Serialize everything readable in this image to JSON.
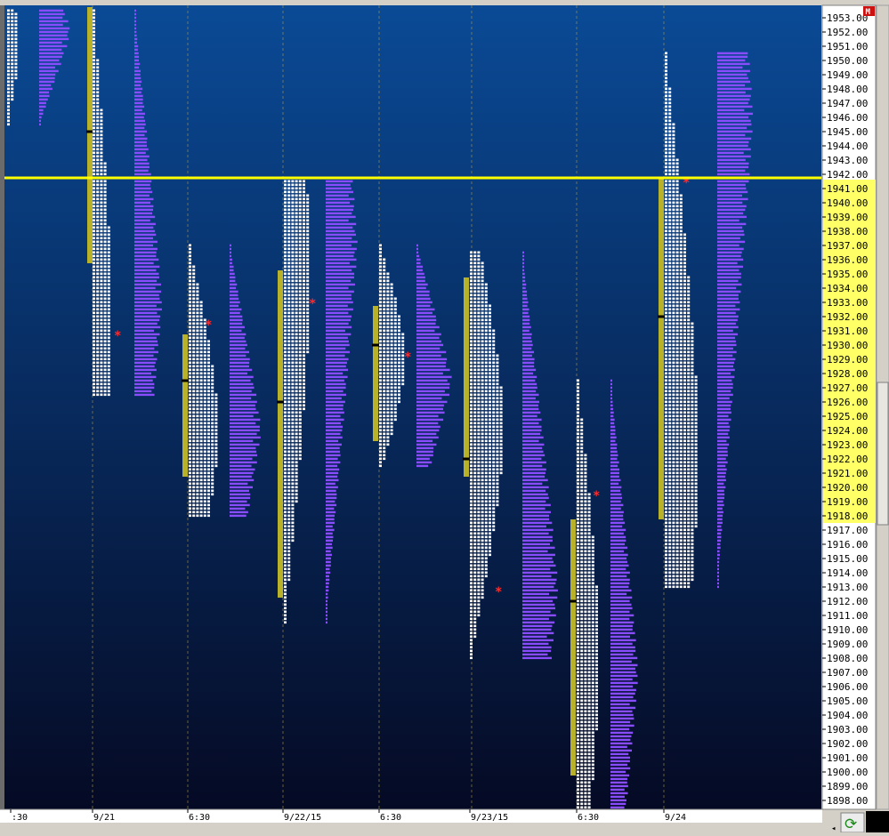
{
  "colors": {
    "bg_top": "#0a4a96",
    "bg_bottom": "#050a24",
    "tpo": "#ffffff",
    "volume": "#8a4cff",
    "value_area": "#b8b22a",
    "price_line": "#ffff00",
    "marker": "#ff2a2a",
    "axis_bg": "#ffffff",
    "axis_highlight": "#ffff66",
    "grid": "#b8a040"
  },
  "toolbar": {
    "m_badge": "M",
    "refresh_icon": "refresh-icon"
  },
  "current_price": 1941.75,
  "chart_data": {
    "type": "market-profile",
    "title": "",
    "y_axis": {
      "range": [
        1897.5,
        1953.75
      ],
      "ticks": [
        "1953.00",
        "1952.00",
        "1951.00",
        "1950.00",
        "1949.00",
        "1948.00",
        "1947.00",
        "1946.00",
        "1945.00",
        "1944.00",
        "1943.00",
        "1942.00",
        "1941.00",
        "1940.00",
        "1939.00",
        "1938.00",
        "1937.00",
        "1936.00",
        "1935.00",
        "1934.00",
        "1933.00",
        "1932.00",
        "1931.00",
        "1930.00",
        "1929.00",
        "1928.00",
        "1927.00",
        "1926.00",
        "1925.00",
        "1924.00",
        "1923.00",
        "1922.00",
        "1921.00",
        "1920.00",
        "1919.00",
        "1918.00",
        "1917.00",
        "1916.00",
        "1915.00",
        "1914.00",
        "1913.00",
        "1912.00",
        "1911.00",
        "1910.00",
        "1909.00",
        "1908.00",
        "1907.00",
        "1906.00",
        "1905.00",
        "1904.00",
        "1903.00",
        "1902.00",
        "1901.00",
        "1900.00",
        "1899.00",
        "1898.00"
      ],
      "highlight_from": 1918.0,
      "highlight_to": 1941.5,
      "highlight_extra": 1922.0
    },
    "x_axis": {
      "ticks": [
        ":30",
        "9/21",
        "6:30",
        "9/22/15",
        "6:30",
        "9/23/15",
        "6:30",
        "9/24"
      ]
    },
    "sessions": [
      {
        "name": "s0",
        "low": 1945.5,
        "high": 1953.5,
        "va_low": null,
        "va_high": null,
        "poc": null,
        "tpo_peak": 1951,
        "tpo_max": 3,
        "vol_peak": 1952,
        "vol_max": 8,
        "marker": null
      },
      {
        "name": "s1",
        "low": 1926.5,
        "high": 1953.5,
        "va_low": 1936,
        "va_high": 1953.5,
        "poc": 1945,
        "tpo_peak": 1932,
        "tpo_max": 5,
        "vol_peak": 1933,
        "vol_max": 7,
        "marker": 1930.75
      },
      {
        "name": "s2",
        "low": 1918,
        "high": 1937,
        "va_low": 1921,
        "va_high": 1930.5,
        "poc": 1927.5,
        "tpo_peak": 1924,
        "tpo_max": 8,
        "vol_peak": 1924,
        "vol_max": 8,
        "marker": 1931.5
      },
      {
        "name": "s3",
        "low": 1910.5,
        "high": 1941.5,
        "va_low": 1912.5,
        "va_high": 1935,
        "poc": 1926,
        "tpo_peak": 1935,
        "tpo_max": 7,
        "vol_peak": 1937,
        "vol_max": 8,
        "marker": 1933
      },
      {
        "name": "s4",
        "low": 1921.5,
        "high": 1937,
        "va_low": 1923.5,
        "va_high": 1932.5,
        "poc": 1930,
        "tpo_peak": 1929,
        "tpo_max": 7,
        "vol_peak": 1927.5,
        "vol_max": 9,
        "marker": 1929.25
      },
      {
        "name": "s5",
        "low": 1908,
        "high": 1936.5,
        "va_low": 1921,
        "va_high": 1934.5,
        "poc": 1922,
        "tpo_peak": 1924,
        "tpo_max": 9,
        "vol_peak": 1913,
        "vol_max": 9,
        "marker": 1912.75
      },
      {
        "name": "s6",
        "low": 1897.5,
        "high": 1927.5,
        "va_low": 1900,
        "va_high": 1917.5,
        "poc": 1912,
        "tpo_peak": 1908,
        "tpo_max": 6,
        "vol_peak": 1907,
        "vol_max": 7,
        "marker": 1919.5
      },
      {
        "name": "s7",
        "low": 1913,
        "high": 1950.5,
        "va_low": 1918,
        "va_high": 1941.5,
        "poc": 1932,
        "tpo_peak": 1922.5,
        "tpo_max": 9,
        "vol_peak": 1946,
        "vol_max": 9,
        "marker": 1941.5
      }
    ]
  }
}
